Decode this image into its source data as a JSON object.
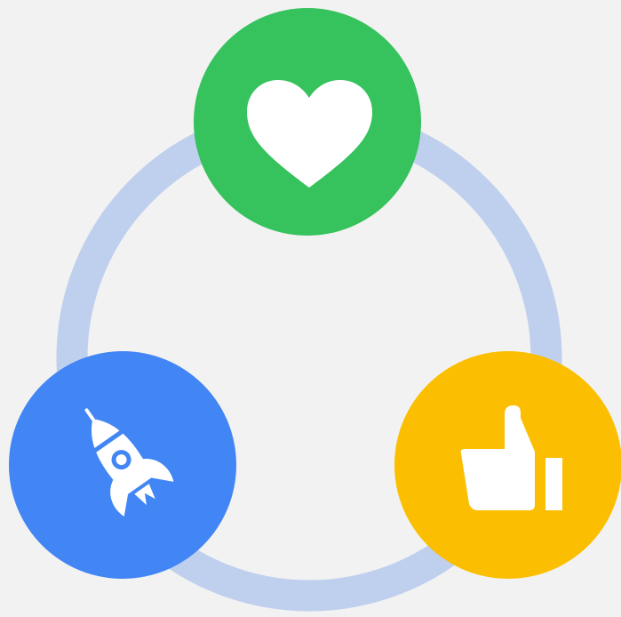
{
  "colors": {
    "background": "#f2f2f2",
    "ring": "#bfcfee",
    "heart_node": "#36c25c",
    "rocket_node": "#4285f4",
    "thumbs_node": "#fbbe00",
    "icon": "#ffffff"
  },
  "nodes": [
    {
      "id": "top",
      "icon": "heart-icon",
      "color": "#36c25c"
    },
    {
      "id": "bottom-left",
      "icon": "rocket-icon",
      "color": "#4285f4"
    },
    {
      "id": "bottom-right",
      "icon": "thumbs-up-icon",
      "color": "#fbbe00"
    }
  ]
}
